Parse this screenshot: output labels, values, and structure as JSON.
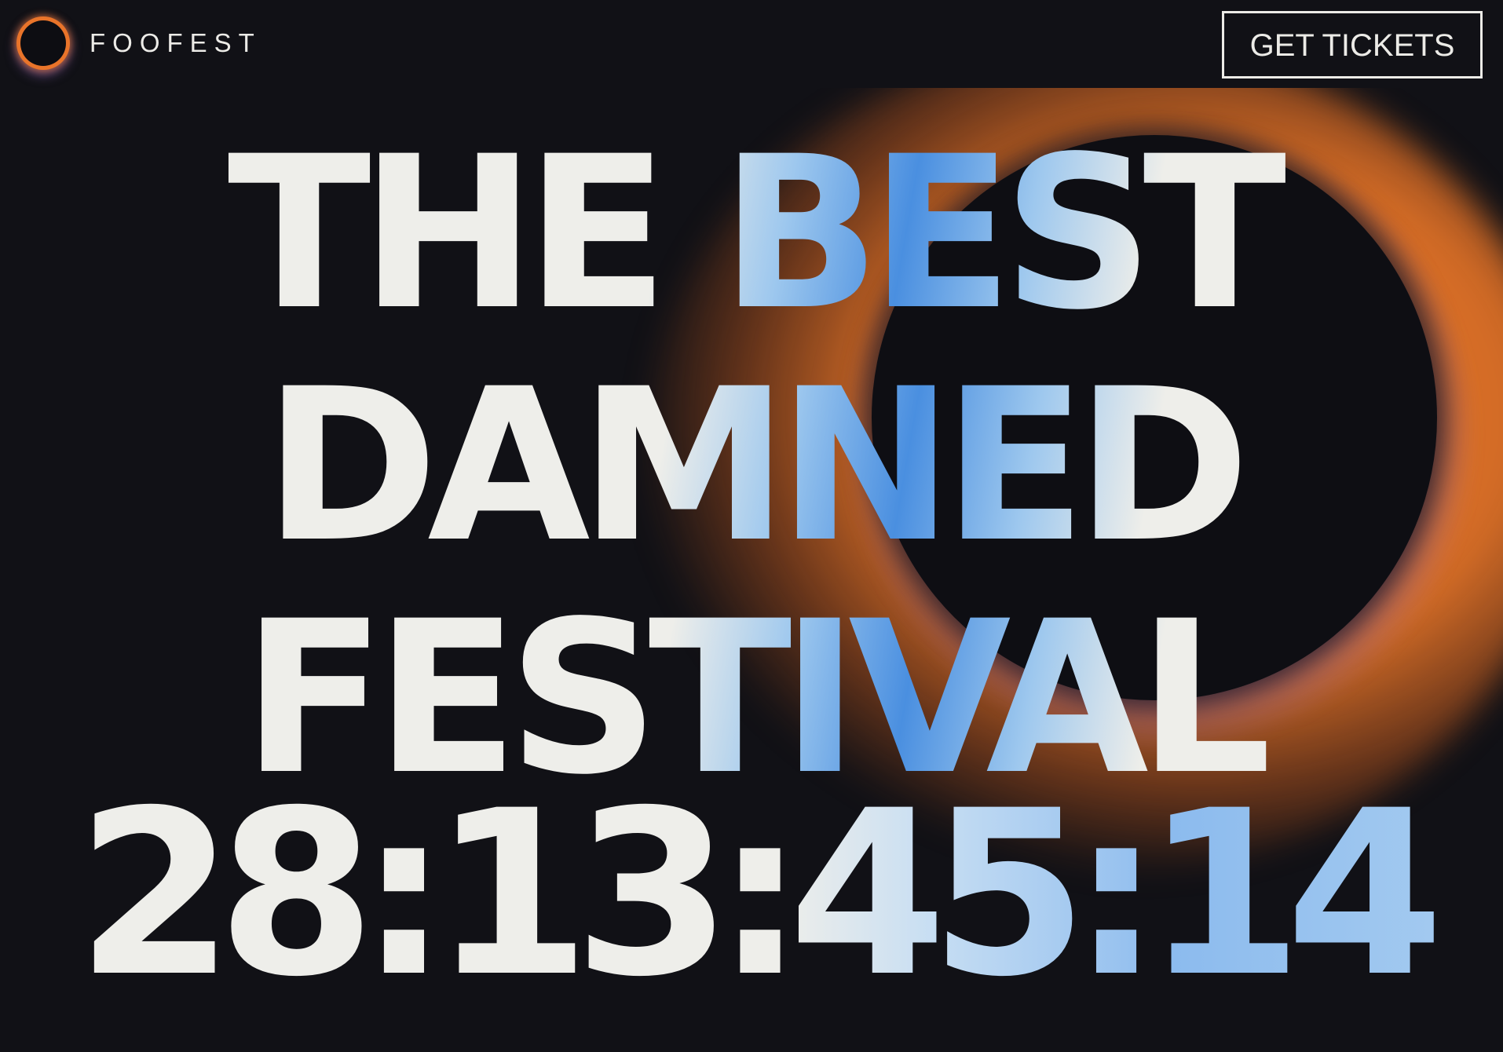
{
  "brand": {
    "name": "FOOFEST",
    "logo_icon": "eclipse-ring-icon"
  },
  "header": {
    "cta_label": "GET TICKETS"
  },
  "hero": {
    "headline_lines": [
      "THE BEST",
      "DAMNED",
      "FESTIVAL"
    ],
    "countdown": "28:13:45:14"
  },
  "colors": {
    "background": "#111116",
    "text": "#eeeeea",
    "accent_orange": "#e9762a",
    "accent_blue": "#4a8fe0",
    "accent_purple": "#966ec8"
  }
}
